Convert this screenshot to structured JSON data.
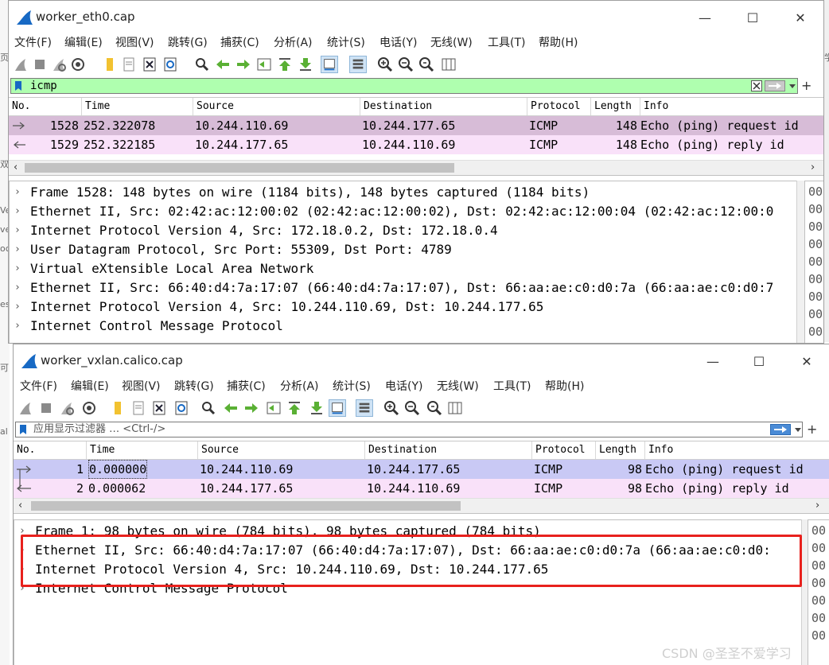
{
  "background_fragments": [
    "页",
    "双",
    "Ve",
    "ve",
    "oc",
    "es",
    "可",
    "al",
    "学"
  ],
  "colors": {
    "filter_applied": "#afffaf",
    "request_row": "#d7bcd7",
    "reply_row": "#f9e1f9",
    "selected_row": "#c9c9f5",
    "highlight_box": "#e8211d"
  },
  "window1": {
    "title": "worker_eth0.cap",
    "controls": {
      "minimize": "—",
      "maximize": "☐",
      "close": "✕"
    },
    "menu": [
      "文件(F)",
      "编辑(E)",
      "视图(V)",
      "跳转(G)",
      "捕获(C)",
      "分析(A)",
      "统计(S)",
      "电话(Y)",
      "无线(W)",
      "工具(T)",
      "帮助(H)"
    ],
    "filter": {
      "value": "icmp",
      "plus": "+"
    },
    "columns": [
      "No.",
      "Time",
      "Source",
      "Destination",
      "Protocol",
      "Length",
      "Info"
    ],
    "packets": [
      {
        "no": "1528",
        "time": "252.322078",
        "source": "10.244.110.69",
        "destination": "10.244.177.65",
        "protocol": "ICMP",
        "length": "148",
        "info": "Echo (ping) request  id"
      },
      {
        "no": "1529",
        "time": "252.322185",
        "source": "10.244.177.65",
        "destination": "10.244.110.69",
        "protocol": "ICMP",
        "length": "148",
        "info": "Echo (ping) reply    id"
      }
    ],
    "details": [
      "Frame 1528: 148 bytes on wire (1184 bits), 148 bytes captured (1184 bits)",
      "Ethernet II, Src: 02:42:ac:12:00:02 (02:42:ac:12:00:02), Dst: 02:42:ac:12:00:04 (02:42:ac:12:00:0",
      "Internet Protocol Version 4, Src: 172.18.0.2, Dst: 172.18.0.4",
      "User Datagram Protocol, Src Port: 55309, Dst Port: 4789",
      "Virtual eXtensible Local Area Network",
      "Ethernet II, Src: 66:40:d4:7a:17:07 (66:40:d4:7a:17:07), Dst: 66:aa:ae:c0:d0:7a (66:aa:ae:c0:d0:7",
      "Internet Protocol Version 4, Src: 10.244.110.69, Dst: 10.244.177.65",
      "Internet Control Message Protocol"
    ],
    "bytes_prefix": [
      "00",
      "00",
      "00",
      "00",
      "00",
      "00",
      "00",
      "00",
      "00"
    ]
  },
  "window2": {
    "title": "worker_vxlan.calico.cap",
    "controls": {
      "minimize": "—",
      "maximize": "☐",
      "close": "✕"
    },
    "menu": [
      "文件(F)",
      "编辑(E)",
      "视图(V)",
      "跳转(G)",
      "捕获(C)",
      "分析(A)",
      "统计(S)",
      "电话(Y)",
      "无线(W)",
      "工具(T)",
      "帮助(H)"
    ],
    "filter": {
      "placeholder": "应用显示过滤器 … <Ctrl-/>",
      "plus": "+"
    },
    "columns": [
      "No.",
      "Time",
      "Source",
      "Destination",
      "Protocol",
      "Length",
      "Info"
    ],
    "packets": [
      {
        "no": "1",
        "time": "0.000000",
        "source": "10.244.110.69",
        "destination": "10.244.177.65",
        "protocol": "ICMP",
        "length": "98",
        "info": "Echo (ping) request  id"
      },
      {
        "no": "2",
        "time": "0.000062",
        "source": "10.244.177.65",
        "destination": "10.244.110.69",
        "protocol": "ICMP",
        "length": "98",
        "info": "Echo (ping) reply    id"
      }
    ],
    "details": [
      "Frame 1: 98 bytes on wire (784 bits), 98 bytes captured (784 bits)",
      "Ethernet II, Src: 66:40:d4:7a:17:07 (66:40:d4:7a:17:07), Dst: 66:aa:ae:c0:d0:7a (66:aa:ae:c0:d0:",
      "Internet Protocol Version 4, Src: 10.244.110.69, Dst: 10.244.177.65",
      "Internet Control Message Protocol"
    ],
    "bytes_prefix": [
      "00",
      "00",
      "00",
      "00",
      "00",
      "00",
      "00"
    ]
  },
  "watermark": "CSDN @圣圣不爱学习"
}
